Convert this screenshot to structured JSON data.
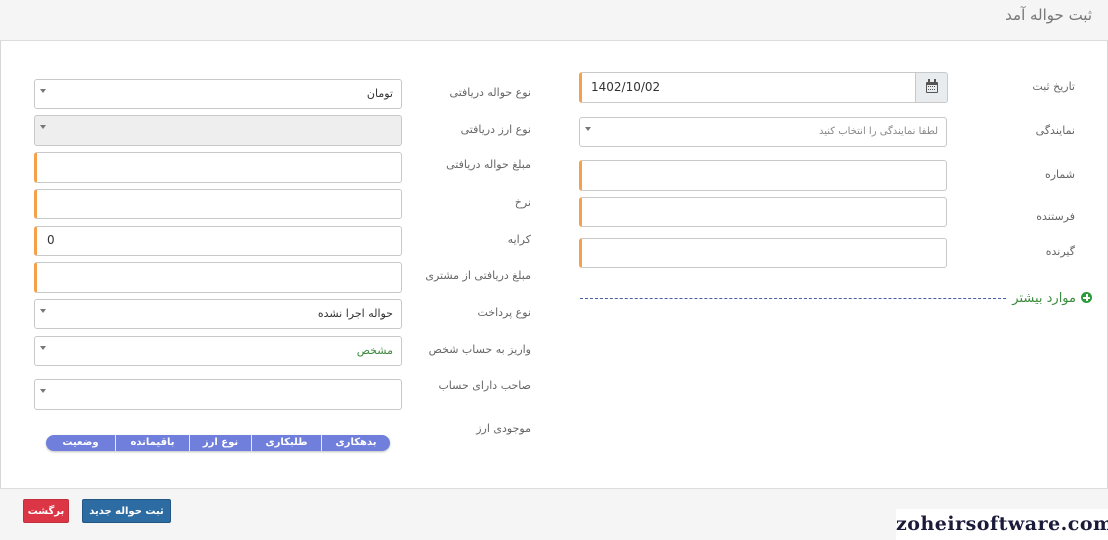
{
  "page": {
    "title": "ثبت حواله آمد"
  },
  "right_form": {
    "date": {
      "label": "تاریخ ثبت",
      "value": "1402/10/02",
      "icon": "calendar-icon"
    },
    "agency": {
      "label": "نمایندگی",
      "placeholder": "لطفا نمایندگی را انتخاب کنید"
    },
    "number": {
      "label": "شماره",
      "value": ""
    },
    "sender": {
      "label": "فرستنده",
      "value": ""
    },
    "receiver": {
      "label": "گیرنده",
      "value": ""
    },
    "more": {
      "label": "موارد بیشتر",
      "icon": "plus-circle-icon"
    }
  },
  "left_form": {
    "received_type": {
      "label": "نوع حواله دریافتی",
      "value": "تومان"
    },
    "received_currency": {
      "label": "نوع ارز دریافتی",
      "value": ""
    },
    "received_amount": {
      "label": "مبلغ حواله دریافتی",
      "value": ""
    },
    "rate": {
      "label": "نرخ",
      "value": ""
    },
    "fee": {
      "label": "کرایه",
      "value": "0"
    },
    "customer_amount": {
      "label": "مبلغ دریافتی از مشتری",
      "value": ""
    },
    "payment_type": {
      "label": "نوع پرداخت",
      "value": "حواله اجرا نشده"
    },
    "deposit_to": {
      "label": "واریز به حساب شخص",
      "value": "مشخص"
    },
    "account_owner": {
      "label": "صاحب دارای حساب",
      "value": ""
    },
    "currency_balance": {
      "label": "موجودی ارز",
      "columns": [
        "بدهکاری",
        "طلبکاری",
        "نوع ارز",
        "باقیمانده",
        "وضعیت"
      ]
    }
  },
  "footer": {
    "submit_label": "ثبت حواله جدید",
    "back_label": "برگشت"
  },
  "watermark": "zoheirsoftware.com",
  "colors": {
    "required_accent": "#f5a04b",
    "primary": "#2d6ca2",
    "danger": "#dc3545",
    "pill": "#6f7fdb",
    "link_green": "#3c8a3c"
  }
}
